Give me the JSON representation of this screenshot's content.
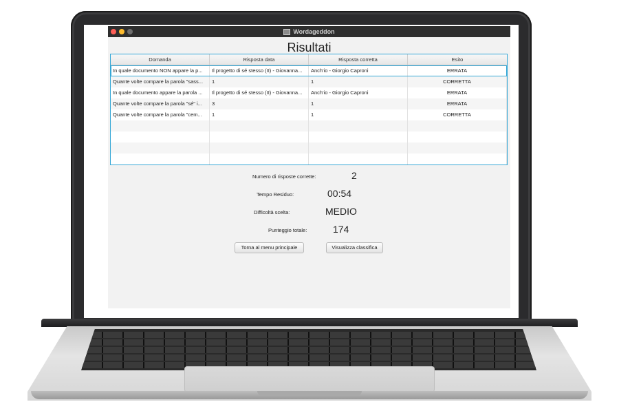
{
  "window": {
    "title": "Wordageddon"
  },
  "page": {
    "heading": "Risultati"
  },
  "table": {
    "columns": [
      "Domanda",
      "Risposta data",
      "Risposta corretta",
      "Esito"
    ],
    "rows": [
      [
        "In quale documento NON appare la p...",
        "Il progetto di sé stesso (II) - Giovanna...",
        "Anch'io - Giorgio Caproni",
        "ERRATA"
      ],
      [
        "Quante volte compare la parola \"sass...",
        "1",
        "1",
        "CORRETTA"
      ],
      [
        "In quale documento appare la parola ...",
        "Il progetto di sé stesso (II) - Giovanna...",
        "Anch'io - Giorgio Caproni",
        "ERRATA"
      ],
      [
        "Quante volte compare la parola \"sé\" i...",
        "3",
        "1",
        "ERRATA"
      ],
      [
        "Quante volte compare la parola \"cem...",
        "1",
        "1",
        "CORRETTA"
      ],
      [
        "",
        "",
        "",
        ""
      ],
      [
        "",
        "",
        "",
        ""
      ],
      [
        "",
        "",
        "",
        ""
      ],
      [
        "",
        "",
        "",
        ""
      ]
    ]
  },
  "stats": {
    "correct_label": "Numero di risposte corrette:",
    "correct_value": "2",
    "time_label": "Tempo Residuo:",
    "time_value": "00:54",
    "difficulty_label": "Difficoltà scelta:",
    "difficulty_value": "MEDIO",
    "score_label": "Punteggio totale:",
    "score_value": "174"
  },
  "buttons": {
    "main_menu": "Torna al menu principale",
    "leaderboard": "Visualizza classifica"
  },
  "icons": {
    "close": "close-dot-icon",
    "minimize": "minimize-dot-icon",
    "maximize": "maximize-dot-icon",
    "app": "app-window-icon"
  },
  "colors": {
    "selection_border": "#34a7d6",
    "traffic_close": "#ff5f57",
    "traffic_minimize": "#febc2e"
  }
}
